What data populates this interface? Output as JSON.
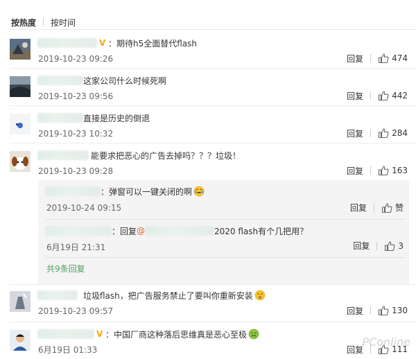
{
  "sort": {
    "active": "按热度",
    "inactive": "按时间"
  },
  "comments": [
    {
      "text": "：期待h5全面替代flash",
      "date": "2019-10-23 09:26",
      "reply": "回复",
      "likes": "474"
    },
    {
      "text": "这家公司什么时候死啊",
      "date": "2019-10-23 09:56",
      "reply": "回复",
      "likes": "442"
    },
    {
      "text": "直接是历史的倒退",
      "date": "2019-10-23 10:32",
      "reply": "回复",
      "likes": "284"
    },
    {
      "text": "能要求把恶心的广告去掉吗？？？垃圾！",
      "date": "2019-10-23 09:28",
      "reply": "回复",
      "likes": "163"
    },
    {
      "text": "垃圾flash，把广告服务禁止了要叫你重新安装",
      "date": "2019-10-23 09:57",
      "reply": "回复",
      "likes": "130"
    },
    {
      "text": "：中国厂商这种落后思维真是恶心至极",
      "date": "6月19日 01:33",
      "reply": "回复",
      "likes": "111"
    }
  ],
  "subreplies": [
    {
      "text": "：弹窗可以一键关闭的啊",
      "date": "2019-10-24 09:15",
      "reply": "回复",
      "likes": "赞"
    },
    {
      "prefix": "：回复",
      "at": "@",
      "suffix": "2020 flash有个几把用？",
      "date": "6月19日 21:31",
      "reply": "回复",
      "likes": "3"
    }
  ],
  "view_more": "共9条回复",
  "watermark": "PConline",
  "colors": {
    "link_green": "#52a060",
    "vip_orange": "#f6a60a",
    "sub_bg": "#f4f4f4"
  }
}
